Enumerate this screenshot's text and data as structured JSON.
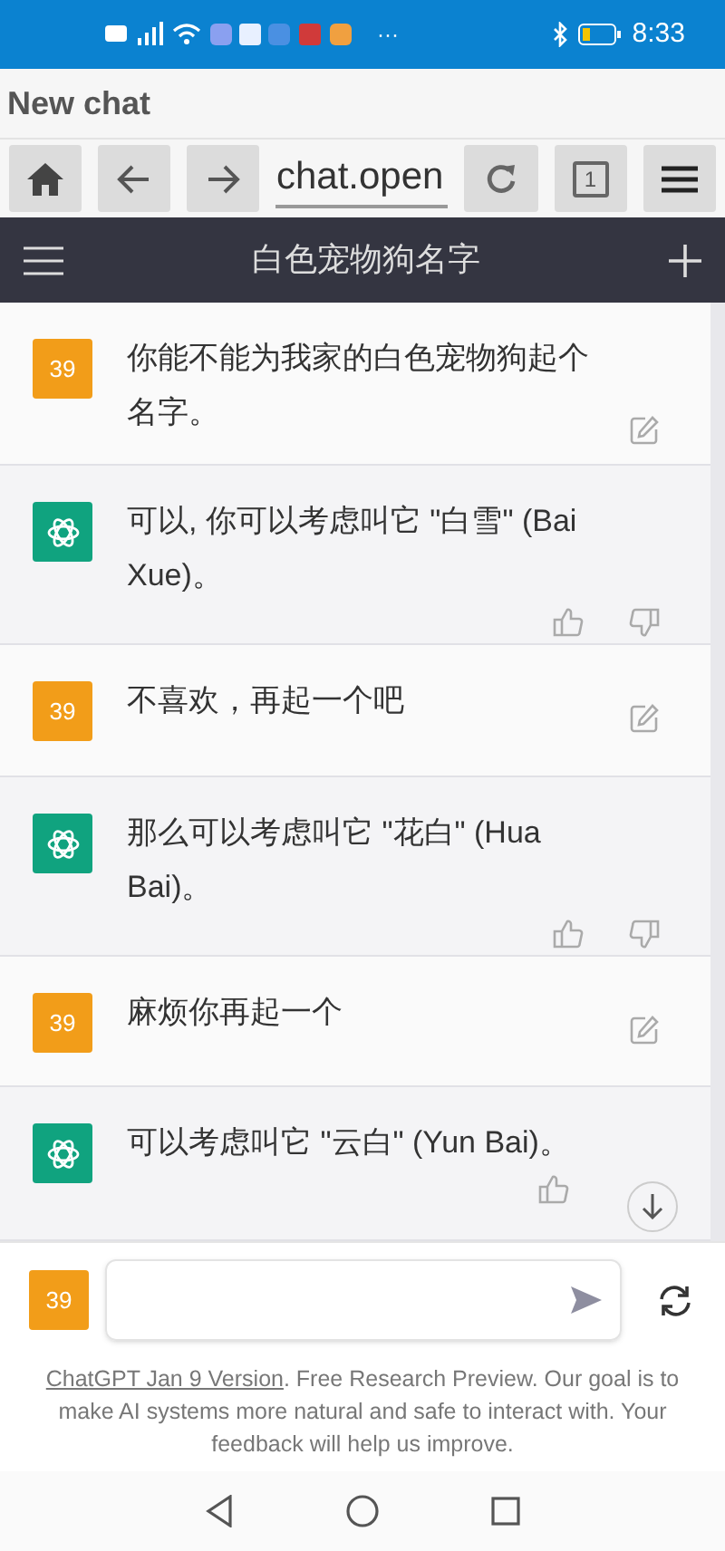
{
  "status_bar": {
    "overflow": "···",
    "time": "8:33"
  },
  "browser": {
    "page_title": "New chat",
    "url": "chat.open",
    "tab_count": "1"
  },
  "header": {
    "title": "白色宠物狗名字"
  },
  "messages": [
    {
      "kind": "user",
      "avatar": "39",
      "text": "你能不能为我家的白色宠物狗起个名字。"
    },
    {
      "kind": "assistant",
      "text": "可以, 你可以考虑叫它 \"白雪\" (Bai Xue)。"
    },
    {
      "kind": "user",
      "avatar": "39",
      "text": "不喜欢，再起一个吧"
    },
    {
      "kind": "assistant",
      "text": "那么可以考虑叫它 \"花白\" (Hua Bai)。"
    },
    {
      "kind": "user",
      "avatar": "39",
      "text": "麻烦你再起一个"
    },
    {
      "kind": "assistant",
      "text": "可以考虑叫它 \"云白\" (Yun Bai)。"
    }
  ],
  "composer": {
    "avatar": "39"
  },
  "footer": {
    "link": "ChatGPT Jan 9 Version",
    "text": ". Free Research Preview. Our goal is to make AI systems more natural and safe to interact with. Your feedback will help us improve."
  }
}
